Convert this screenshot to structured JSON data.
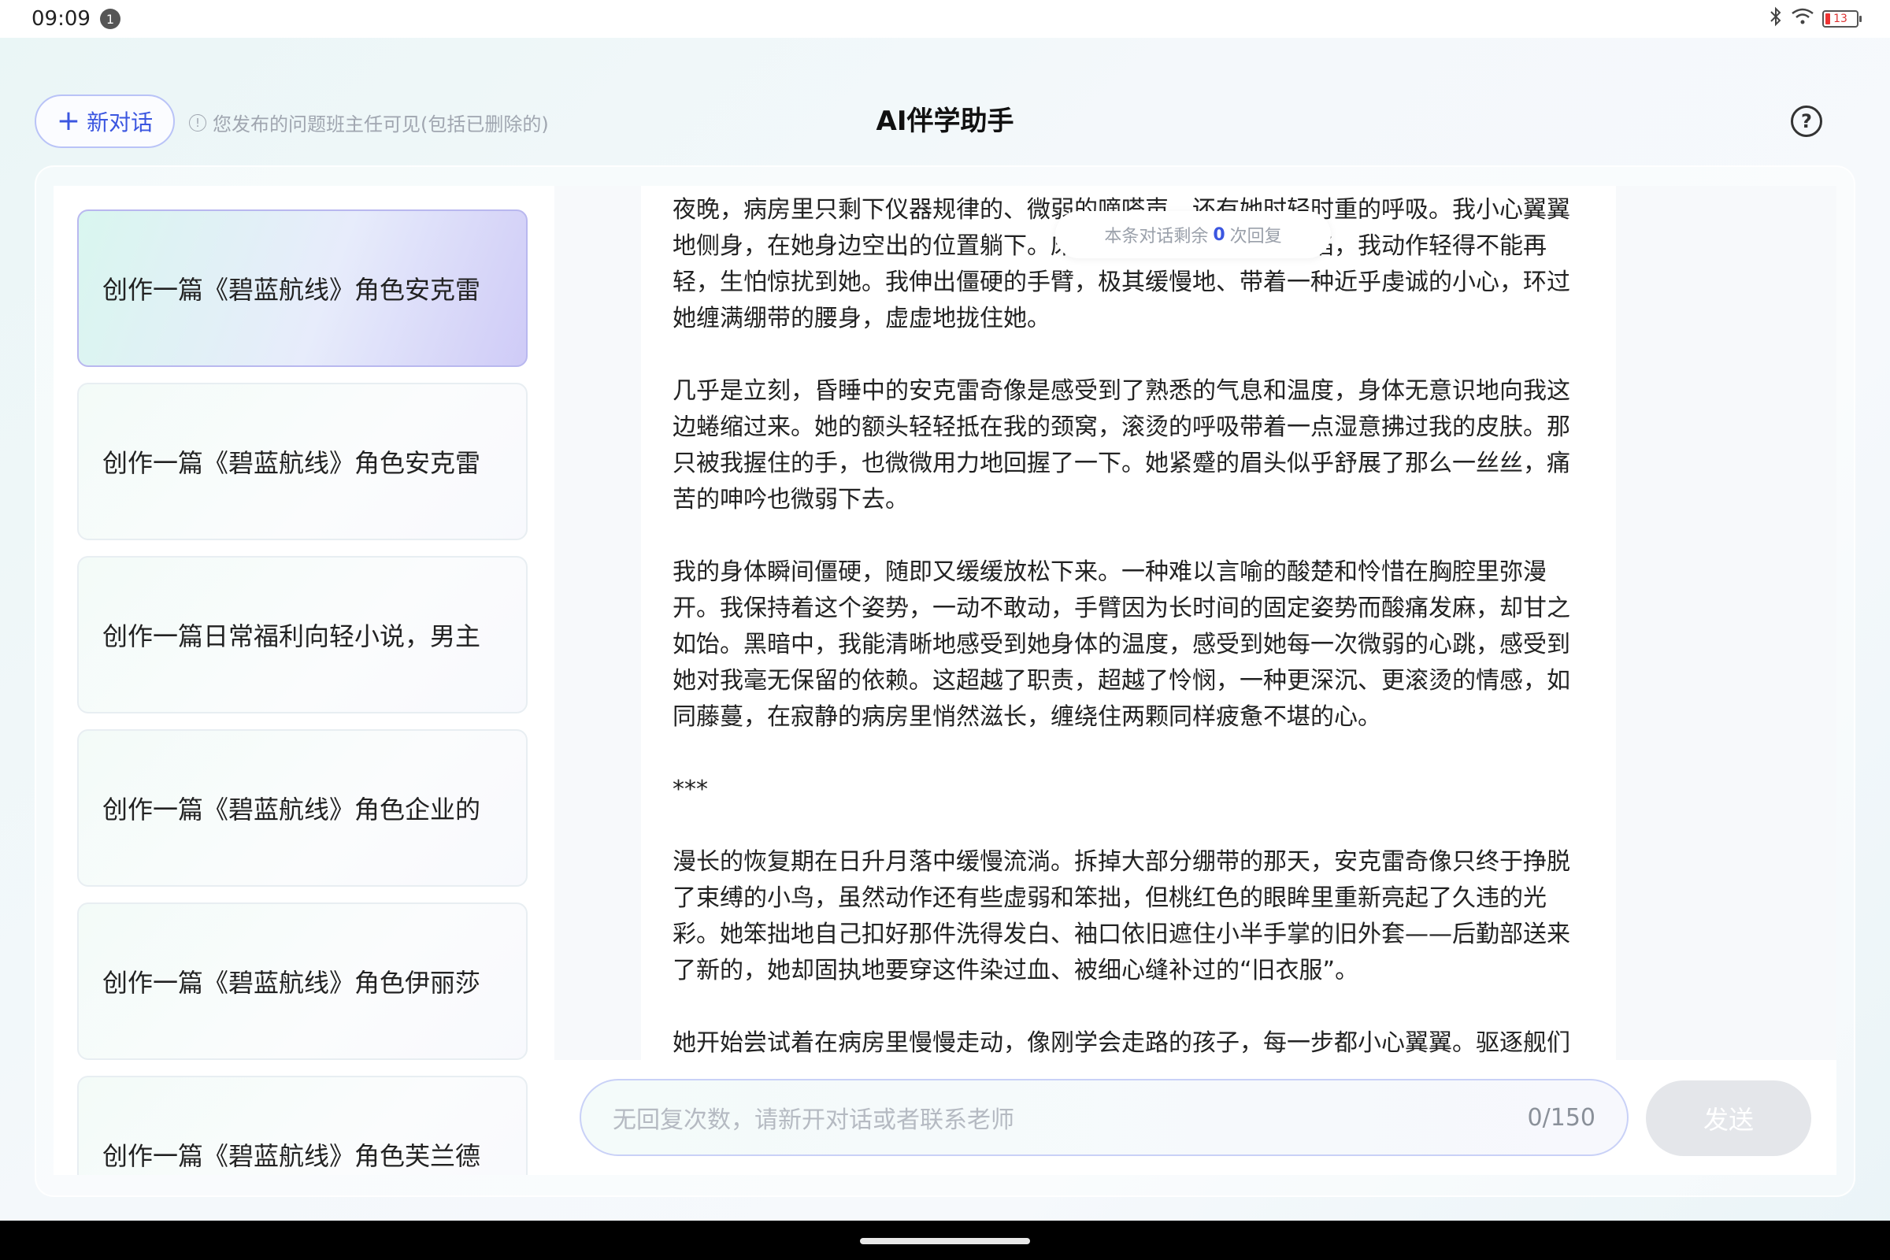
{
  "status_bar": {
    "time": "09:09",
    "notification_count": "1",
    "battery": "13",
    "icons": [
      "bluetooth-icon",
      "wifi-icon",
      "battery-icon"
    ]
  },
  "header": {
    "new_chat_label": "新对话",
    "notice": "您发布的问题班主任可见(包括已删除的)",
    "title": "AI伴学助手",
    "help_symbol": "?"
  },
  "sidebar": {
    "items": [
      {
        "label": "创作一篇《碧蓝航线》角色安克雷",
        "active": true
      },
      {
        "label": "创作一篇《碧蓝航线》角色安克雷",
        "active": false
      },
      {
        "label": "创作一篇日常福利向轻小说，男主",
        "active": false
      },
      {
        "label": "创作一篇《碧蓝航线》角色企业的",
        "active": false
      },
      {
        "label": "创作一篇《碧蓝航线》角色伊丽莎",
        "active": false
      },
      {
        "label": "创作一篇《碧蓝航线》角色芙兰德",
        "active": false
      }
    ]
  },
  "chat": {
    "remaining_prefix": "本条对话剩余",
    "remaining_count": "0",
    "remaining_suffix": "次回复",
    "paragraphs": [
      "夜晚，病房里只剩下仪器规律的、微弱的嘀嗒声，还有她时轻时重的呼吸。我小心翼翼地侧身，在她身边空出的位置躺下。床垫因为我的重量微微下陷，我动作轻得不能再轻，生怕惊扰到她。我伸出僵硬的手臂，极其缓慢地、带着一种近乎虔诚的小心，环过她缠满绷带的腰身，虚虚地拢住她。",
      "几乎是立刻，昏睡中的安克雷奇像是感受到了熟悉的气息和温度，身体无意识地向我这边蜷缩过来。她的额头轻轻抵在我的颈窝，滚烫的呼吸带着一点湿意拂过我的皮肤。那只被我握住的手，也微微用力地回握了一下。她紧蹙的眉头似乎舒展了那么一丝丝，痛苦的呻吟也微弱下去。",
      "我的身体瞬间僵硬，随即又缓缓放松下来。一种难以言喻的酸楚和怜惜在胸腔里弥漫开。我保持着这个姿势，一动不敢动，手臂因为长时间的固定姿势而酸痛发麻，却甘之如饴。黑暗中，我能清晰地感受到她身体的温度，感受到她每一次微弱的心跳，感受到她对我毫无保留的依赖。这超越了职责，超越了怜悯，一种更深沉、更滚烫的情感，如同藤蔓，在寂静的病房里悄然滋长，缠绕住两颗同样疲惫不堪的心。",
      "***",
      "漫长的恢复期在日升月落中缓慢流淌。拆掉大部分绷带的那天，安克雷奇像只终于挣脱了束缚的小鸟，虽然动作还有些虚弱和笨拙，但桃红色的眼眸里重新亮起了久违的光彩。她笨拙地自己扣好那件洗得发白、袖口依旧遮住小半手掌的旧外套——后勤部送来了新的，她却固执地要穿这件染过血、被细心缝补过的“旧衣服”。",
      "她开始尝试着在病房里慢慢走动，像刚学会走路的孩子，每一步都小心翼翼。驱逐舰们"
    ]
  },
  "input": {
    "placeholder": "无回复次数，请新开对话或者联系老师",
    "counter": "0/150",
    "send_label": "发送"
  }
}
